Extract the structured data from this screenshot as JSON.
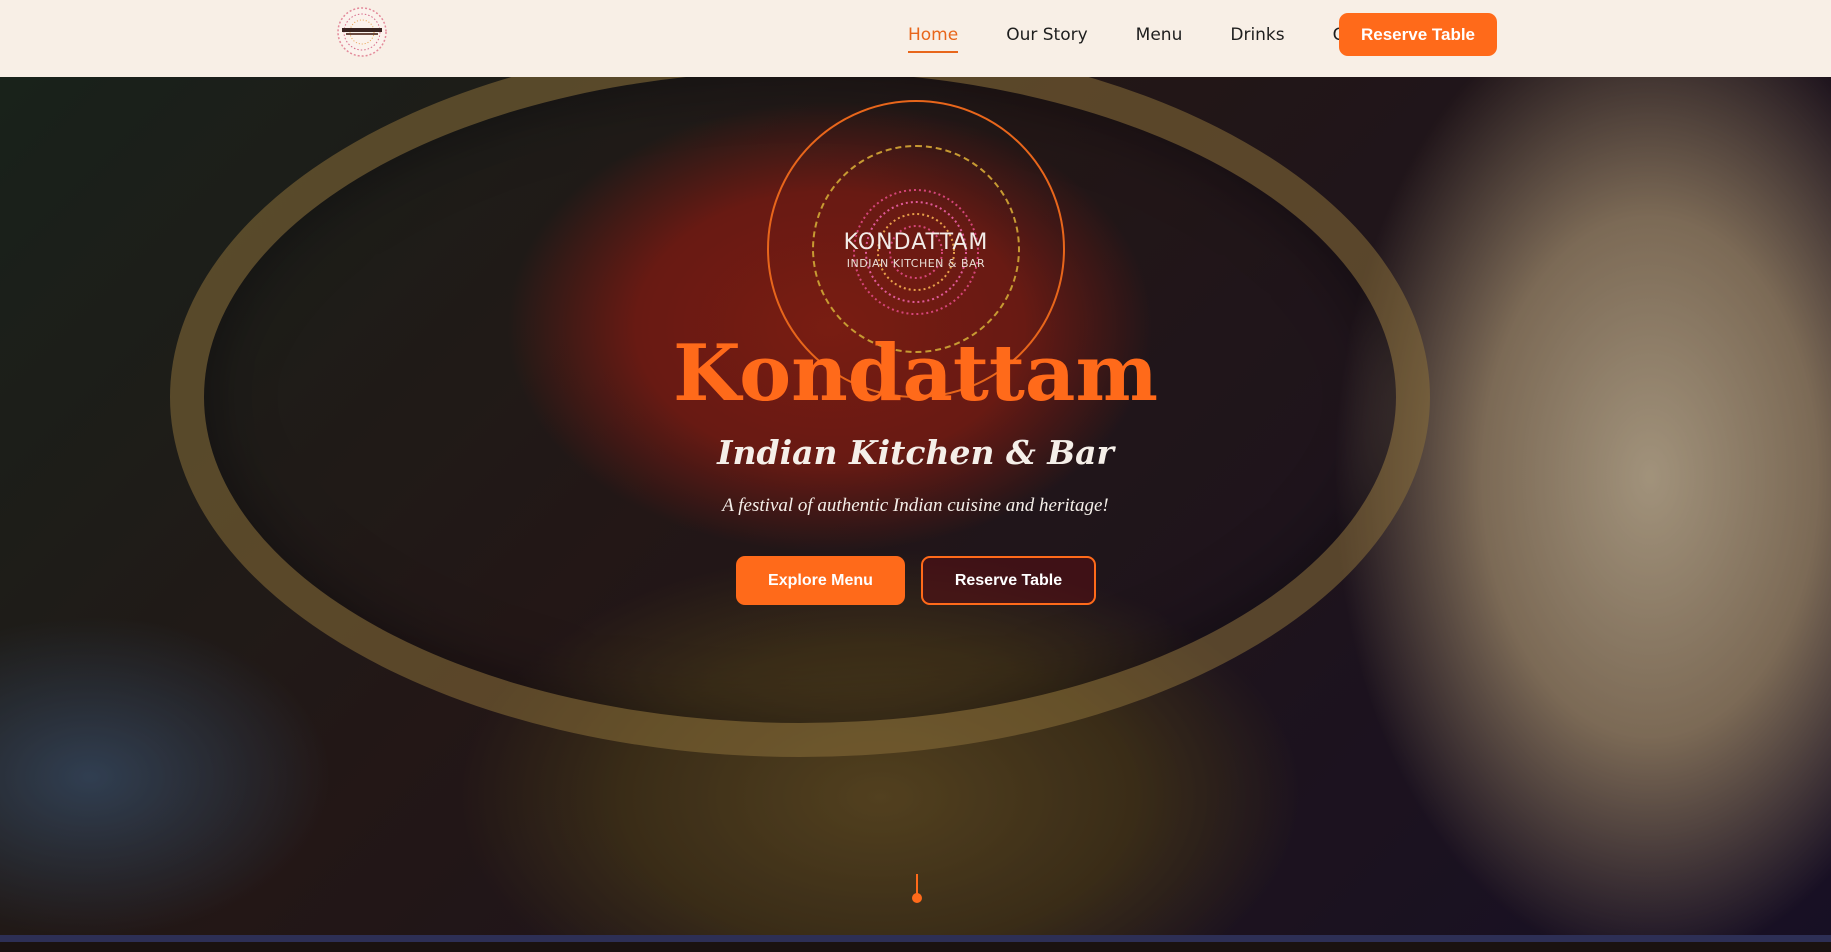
{
  "nav": {
    "logo_icon": "kondattam-mandala-logo",
    "links": [
      {
        "label": "Home",
        "active": true
      },
      {
        "label": "Our Story",
        "active": false
      },
      {
        "label": "Menu",
        "active": false
      },
      {
        "label": "Drinks",
        "active": false
      },
      {
        "label": "Contact",
        "active": false
      }
    ],
    "cta_label": "Reserve Table"
  },
  "hero": {
    "emblem_word": "KONDATTAM",
    "emblem_sub": "INDIAN KITCHEN & BAR",
    "title": "Kondattam",
    "subtitle": "Indian Kitchen & Bar",
    "tagline": "A festival of authentic Indian cuisine and heritage!",
    "explore_label": "Explore Menu",
    "reserve_label": "Reserve Table",
    "background_icon": "curry-bowl-and-naan-photo"
  },
  "colors": {
    "accent": "#ff6a1a",
    "nav_bg": "#f8efe6",
    "text_dark": "#1e1e1e",
    "text_light": "#f5efe9",
    "gold": "#c79a32"
  }
}
